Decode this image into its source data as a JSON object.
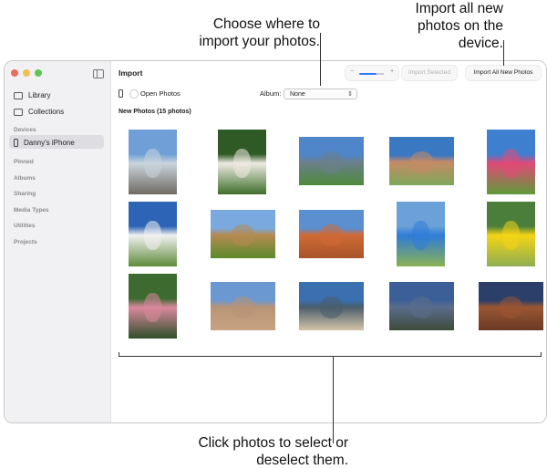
{
  "callouts": {
    "choose": "Choose where to import your photos.",
    "import_all": "Import all new photos on the device.",
    "click": "Click photos to select or deselect them."
  },
  "window": {
    "title": "Import"
  },
  "traffic_lights": [
    "#ec6a5e",
    "#f4bf4f",
    "#61c554"
  ],
  "sidebar": {
    "library": "Library",
    "collections": "Collections",
    "devices_header": "Devices",
    "device": "Danny's iPhone",
    "sections": [
      "Pinned",
      "Albums",
      "Sharing",
      "Media Types",
      "Utilities",
      "Projects"
    ]
  },
  "toolbar": {
    "zoom_out": "−",
    "zoom_in": "+",
    "import_selected": "Import Selected",
    "import_all": "Import All New Photos"
  },
  "options": {
    "open_photos": "Open Photos",
    "album_label": "Album:",
    "album_value": "None"
  },
  "photos_header": "New Photos (15 photos)",
  "photos": [
    {
      "subject": "sky-over-sand-beach",
      "colors": [
        "#6f9fd6",
        "#c9d4dc",
        "#716a62"
      ]
    },
    {
      "subject": "white-dog-in-foliage",
      "colors": [
        "#2f5a25",
        "#eeeae2",
        "#3e6f2c"
      ]
    },
    {
      "subject": "mountain-meadow",
      "colors": [
        "#4e86c9",
        "#6b7f8d",
        "#4f8a3c"
      ]
    },
    {
      "subject": "girl-smiling-in-field",
      "colors": [
        "#3a78c2",
        "#c58a66",
        "#7ea75b"
      ]
    },
    {
      "subject": "girl-in-sunflowers",
      "colors": [
        "#3f7fcf",
        "#e04a78",
        "#5f9c3a"
      ]
    },
    {
      "subject": "clouds-over-grassland",
      "colors": [
        "#2d64b5",
        "#f1f1f1",
        "#5f8a3a"
      ]
    },
    {
      "subject": "green-hillside",
      "colors": [
        "#7aa9df",
        "#b58a52",
        "#5b8a2a"
      ]
    },
    {
      "subject": "orange-rock-formation",
      "colors": [
        "#5a8fd0",
        "#cf6a35",
        "#a8542a"
      ]
    },
    {
      "subject": "child-with-balloons",
      "colors": [
        "#6aa1d8",
        "#2f7cd8",
        "#8bb152"
      ]
    },
    {
      "subject": "girl-with-yellow-ball",
      "colors": [
        "#4a7e3a",
        "#f4d416",
        "#8fae53"
      ]
    },
    {
      "subject": "girl-in-pink-hoodie",
      "colors": [
        "#3c6a2f",
        "#d9889d",
        "#2f4f29"
      ]
    },
    {
      "subject": "desert-salt-flat",
      "colors": [
        "#6b98d1",
        "#b89476",
        "#c7a281"
      ]
    },
    {
      "subject": "dry-lakebed-mountains",
      "colors": [
        "#3a6fb0",
        "#4a5d6c",
        "#d3c3a8"
      ]
    },
    {
      "subject": "dusk-over-hills",
      "colors": [
        "#3c5f97",
        "#5a6d8c",
        "#3e4a3a"
      ]
    },
    {
      "subject": "sandstone-rocks-sunset",
      "colors": [
        "#2a3f6a",
        "#9a5633",
        "#6a3a24"
      ]
    }
  ]
}
